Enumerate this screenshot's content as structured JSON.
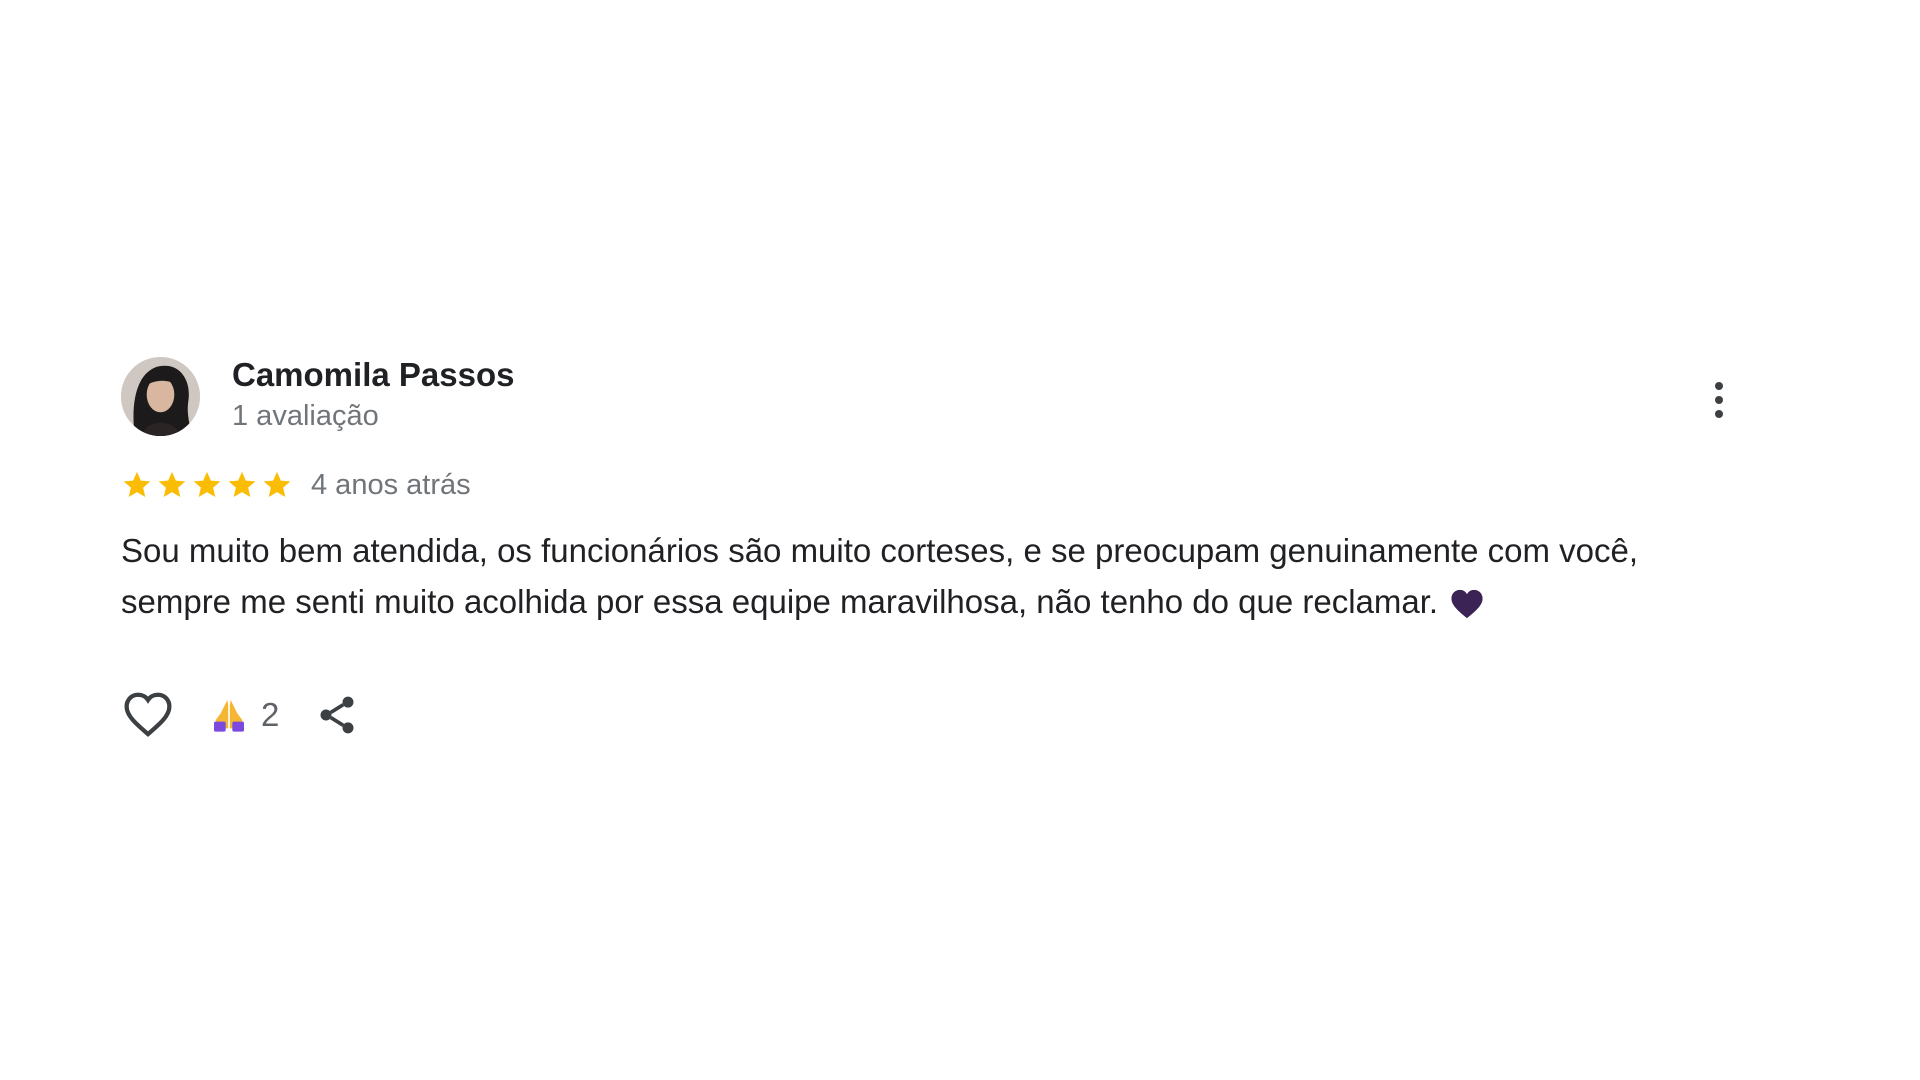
{
  "review": {
    "reviewer_name": "Camomila Passos",
    "reviewer_meta": "1 avaliação",
    "rating": 5,
    "rating_max": 5,
    "date": "4 anos atrás",
    "text_lines": [
      "Sou muito bem atendida, os funcionários são muito corteses, e se preocupam genuinamente com você,",
      "sempre me senti muito acolhida por essa equipe maravilhosa, não tenho do que reclamar."
    ],
    "text_emoji": "black-heart-emoji",
    "reaction_count": "2"
  },
  "icons": {
    "avatar": "avatar-photo",
    "more": "more-vert-icon",
    "star": "star-icon",
    "like": "heart-outline-icon",
    "reaction": "folded-hands-emoji",
    "share": "share-icon"
  },
  "colors": {
    "star": "#fbbc04",
    "name": "#202124",
    "meta": "#70757a",
    "text": "#202124",
    "icon": "#3c4043",
    "heart_emoji": "#3b2355",
    "reaction_emoji": "#7b48e0"
  }
}
